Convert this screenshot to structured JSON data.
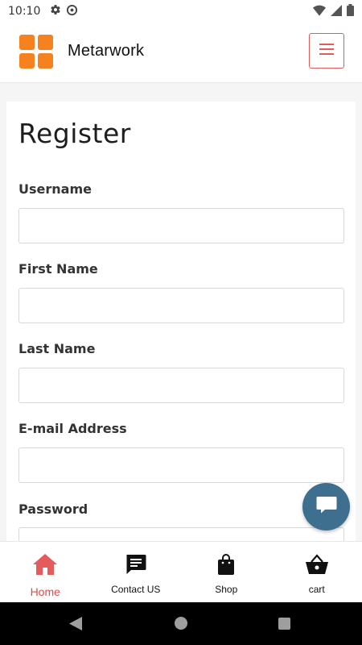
{
  "status_bar": {
    "time": "10:10",
    "icons": [
      "gear-icon",
      "data-saver-icon",
      "wifi-icon",
      "signal-icon",
      "battery-icon"
    ]
  },
  "header": {
    "brand_name": "Metarwork",
    "logo_color": "#f5821f",
    "menu_icon": "hamburger-menu-icon",
    "menu_border_color": "#e25b5b"
  },
  "form": {
    "title": "Register",
    "fields": [
      {
        "label": "Username",
        "value": ""
      },
      {
        "label": "First Name",
        "value": ""
      },
      {
        "label": "Last Name",
        "value": ""
      },
      {
        "label": "E-mail Address",
        "value": ""
      },
      {
        "label": "Password",
        "value": ""
      }
    ]
  },
  "chat_fab": {
    "icon": "chat-bubble-icon",
    "color": "#3f6f8e"
  },
  "bottom_nav": {
    "active_color": "#e24a4a",
    "items": [
      {
        "label": "Home",
        "icon": "home-icon",
        "active": true
      },
      {
        "label": "Contact US",
        "icon": "message-icon",
        "active": false
      },
      {
        "label": "Shop",
        "icon": "shopping-bag-icon",
        "active": false
      },
      {
        "label": "cart",
        "icon": "basket-icon",
        "active": false
      }
    ]
  },
  "system_nav": {
    "icons": [
      "back-icon",
      "home-circle-icon",
      "recents-icon"
    ]
  }
}
